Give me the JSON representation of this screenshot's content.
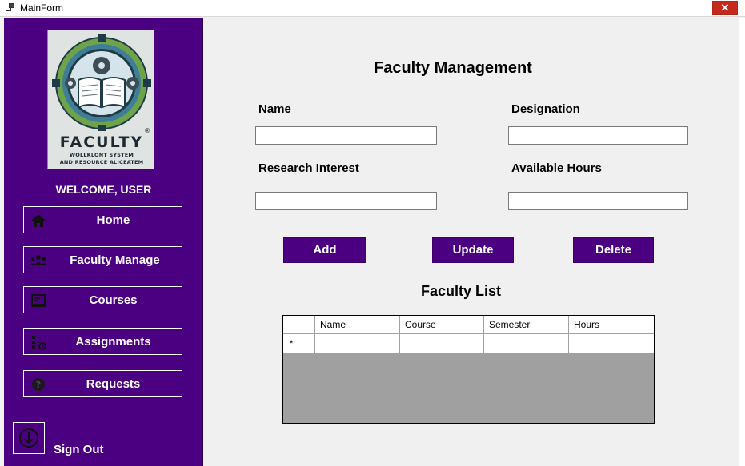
{
  "window": {
    "title": "MainForm",
    "close_glyph": "✕"
  },
  "sidebar": {
    "logo": {
      "title": "FACULTY",
      "line1": "WOLLKLONT SYSTEM",
      "line2": "AND RESOURCE ALICEATEM",
      "mark": "®"
    },
    "welcome": "WELCOME, USER",
    "items": [
      {
        "label": "Home",
        "icon": "home-icon"
      },
      {
        "label": "Faculty Manage",
        "icon": "users-icon"
      },
      {
        "label": "Courses",
        "icon": "monitor-icon"
      },
      {
        "label": "Assignments",
        "icon": "assignment-icon"
      },
      {
        "label": "Requests",
        "icon": "question-icon"
      }
    ],
    "sign_out": "Sign Out"
  },
  "main": {
    "title": "Faculty Management",
    "fields": {
      "name": {
        "label": "Name",
        "value": ""
      },
      "designation": {
        "label": "Designation",
        "value": ""
      },
      "research_interest": {
        "label": "Research Interest",
        "value": ""
      },
      "available_hours": {
        "label": "Available Hours",
        "value": ""
      }
    },
    "buttons": {
      "add": "Add",
      "update": "Update",
      "delete": "Delete"
    },
    "list_title": "Faculty List",
    "grid": {
      "columns": [
        "Name",
        "Course",
        "Semester",
        "Hours"
      ],
      "new_row_marker": "*",
      "rows": []
    }
  },
  "colors": {
    "sidebar_bg": "#4b0082",
    "button_bg": "#4b0082",
    "grid_empty_bg": "#a0a0a0"
  }
}
